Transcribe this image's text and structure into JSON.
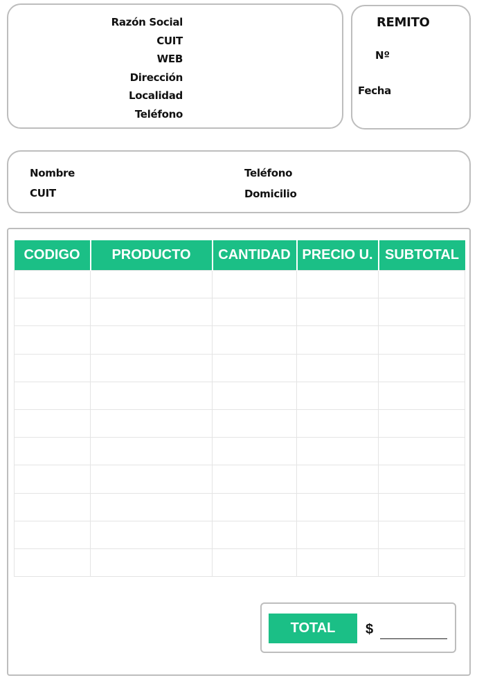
{
  "company": {
    "fields": [
      "Razón Social",
      "CUIT",
      "WEB",
      "Dirección",
      "Localidad",
      "Teléfono"
    ]
  },
  "remito": {
    "title": "REMITO",
    "number_label": "Nº",
    "date_label": "Fecha"
  },
  "client": {
    "name_label": "Nombre",
    "cuit_label": "CUIT",
    "phone_label": "Teléfono",
    "address_label": "Domicilio"
  },
  "items_table": {
    "columns": [
      "CODIGO",
      "PRODUCTO",
      "CANTIDAD",
      "PRECIO U.",
      "SUBTOTAL"
    ],
    "rows": [
      [
        "",
        "",
        "",
        "",
        ""
      ],
      [
        "",
        "",
        "",
        "",
        ""
      ],
      [
        "",
        "",
        "",
        "",
        ""
      ],
      [
        "",
        "",
        "",
        "",
        ""
      ],
      [
        "",
        "",
        "",
        "",
        ""
      ],
      [
        "",
        "",
        "",
        "",
        ""
      ],
      [
        "",
        "",
        "",
        "",
        ""
      ],
      [
        "",
        "",
        "",
        "",
        ""
      ],
      [
        "",
        "",
        "",
        "",
        ""
      ],
      [
        "",
        "",
        "",
        "",
        ""
      ],
      [
        "",
        "",
        "",
        "",
        ""
      ]
    ]
  },
  "total": {
    "label": "TOTAL",
    "currency": "$",
    "value": ""
  },
  "colors": {
    "accent": "#1bbf86",
    "border": "#bdbdbd",
    "grid": "#e4e4e4"
  }
}
